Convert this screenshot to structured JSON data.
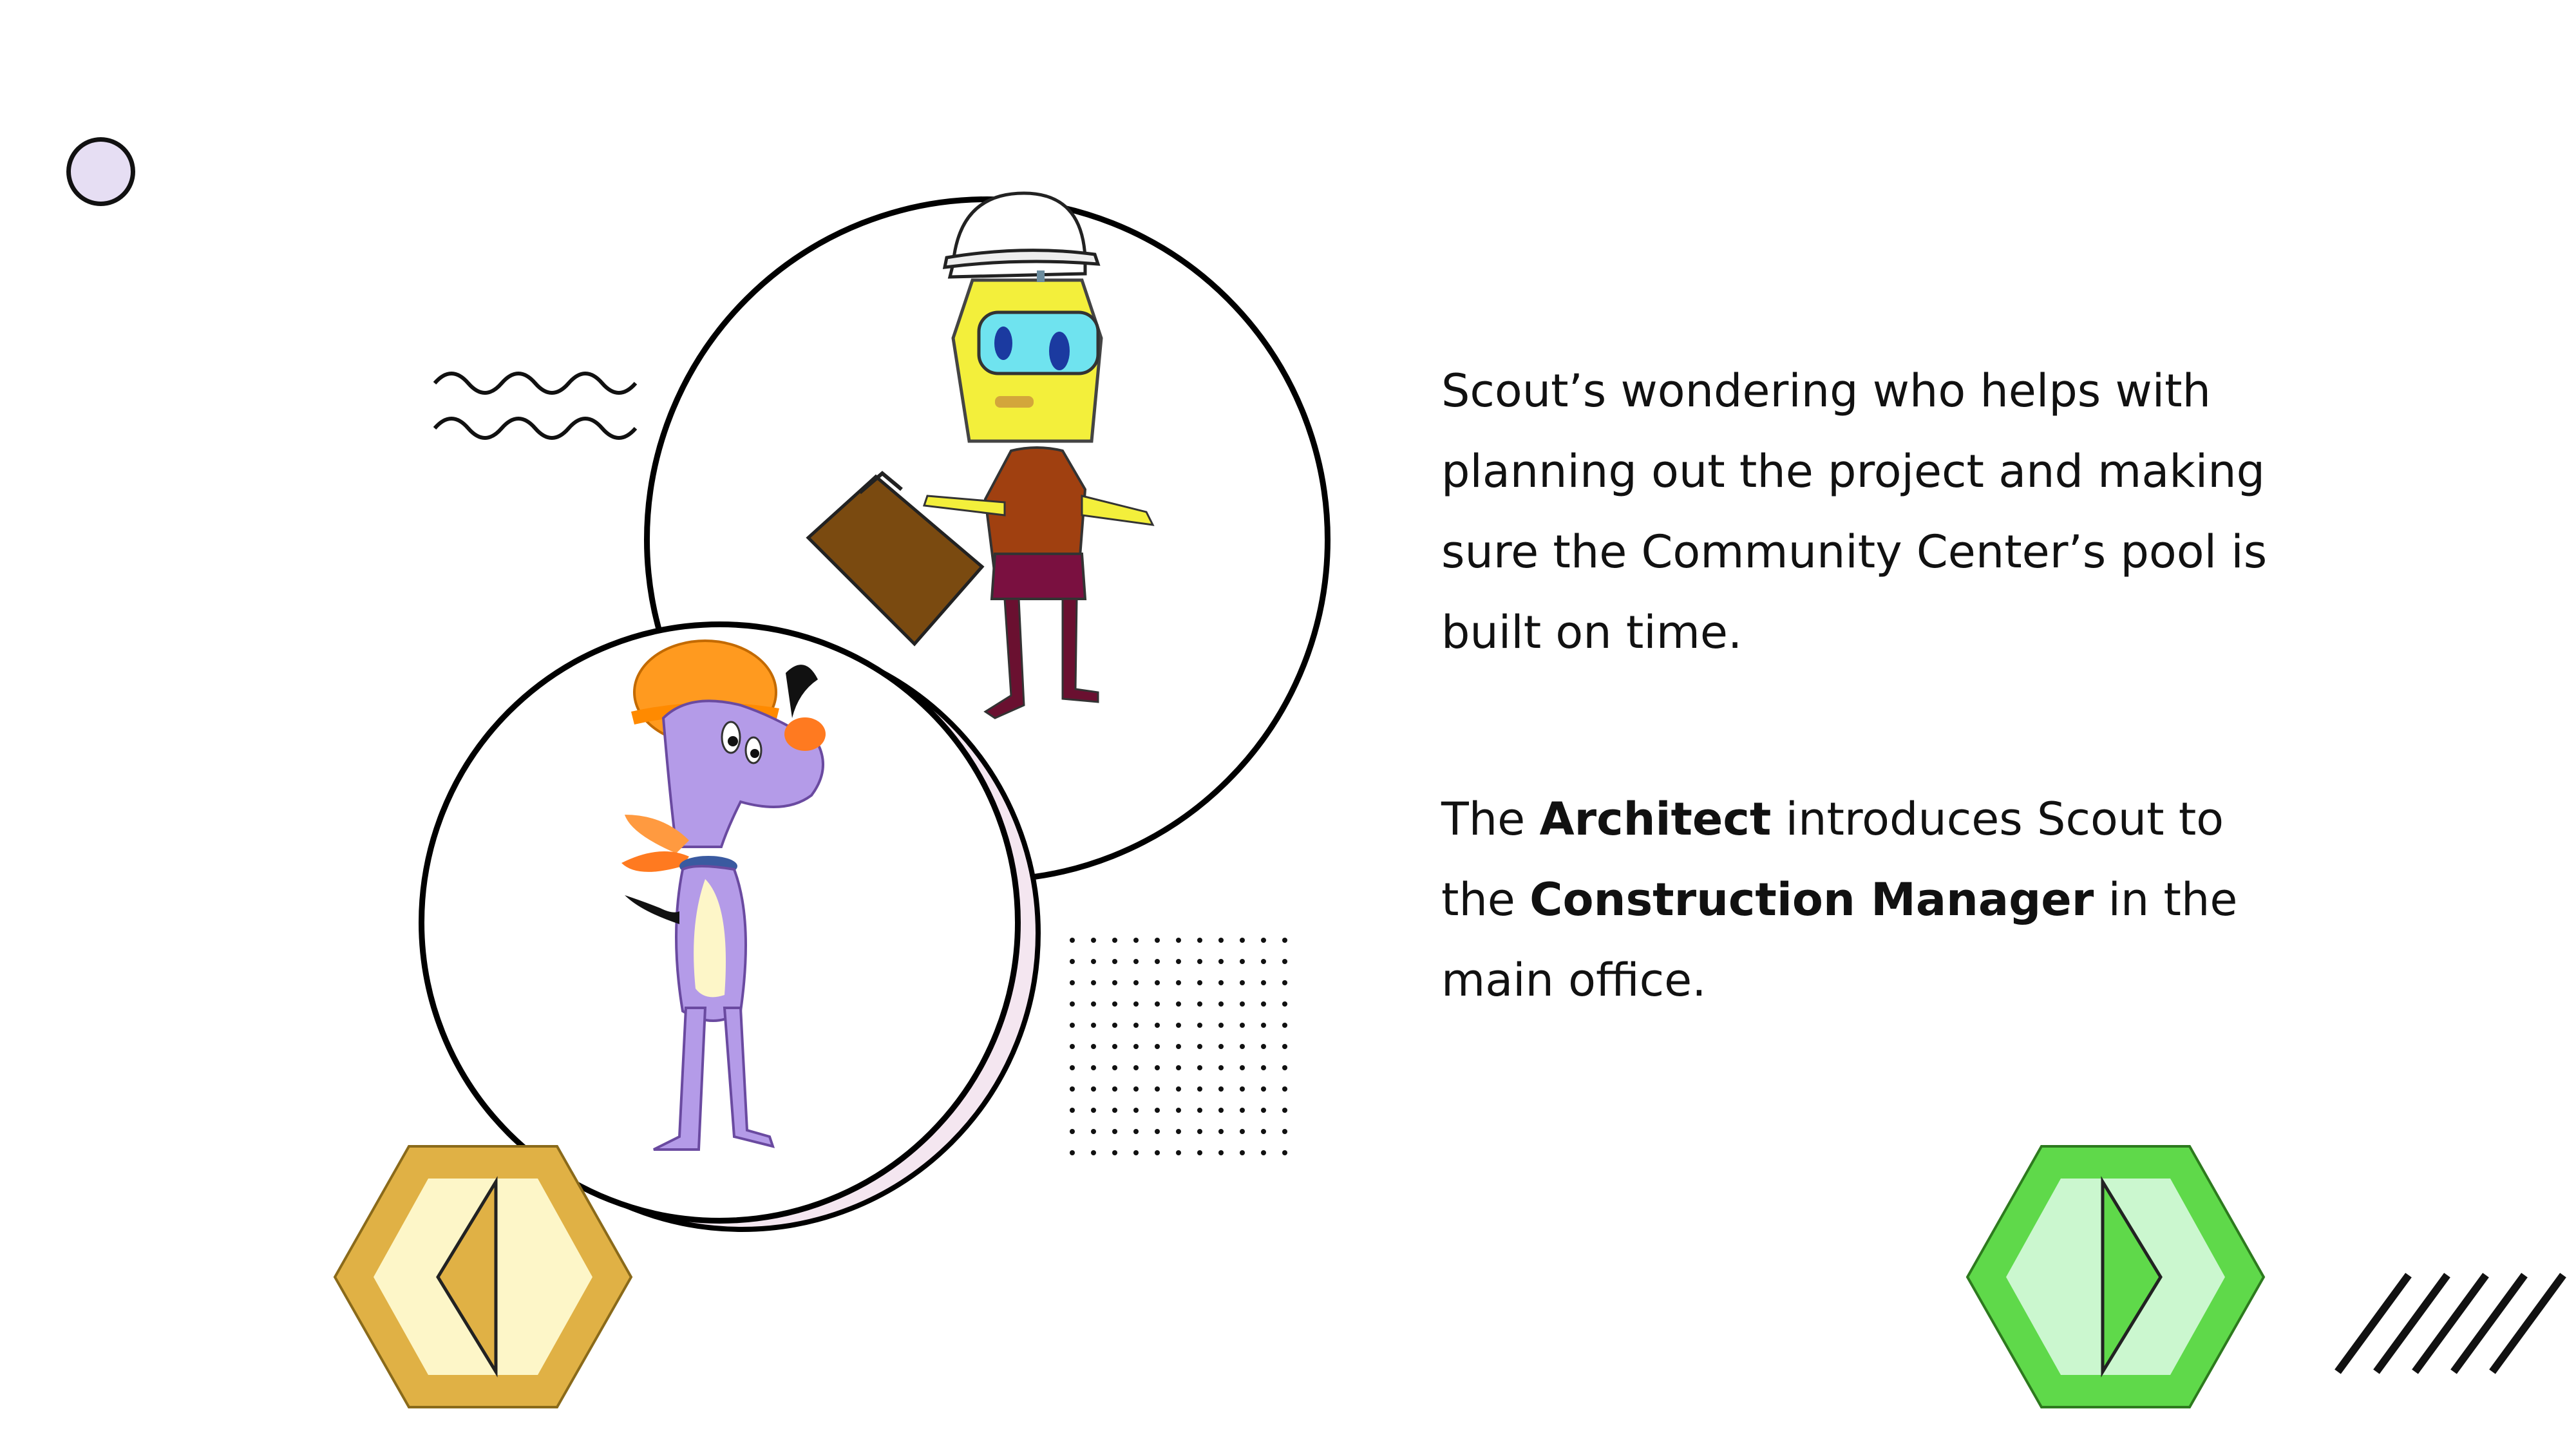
{
  "content": {
    "paragraph1": "Scout’s  wondering who helps with planning out the project and making sure the Community Center’s pool is built on time.",
    "paragraph2": {
      "part1": "The ",
      "bold1": "Architect",
      "part2": " introduces Scout to the ",
      "bold2": "Construction Manager",
      "part3": " in the main office."
    }
  },
  "navigation": {
    "back_icon": "left-triangle-icon",
    "next_icon": "right-triangle-icon",
    "back_color": "#e0b145",
    "next_color": "#5fd94a"
  },
  "illustrations": {
    "top_character": "robot-architect-with-hardhat-and-briefcase",
    "bottom_character": "purple-dog-scout-with-hardhat"
  }
}
